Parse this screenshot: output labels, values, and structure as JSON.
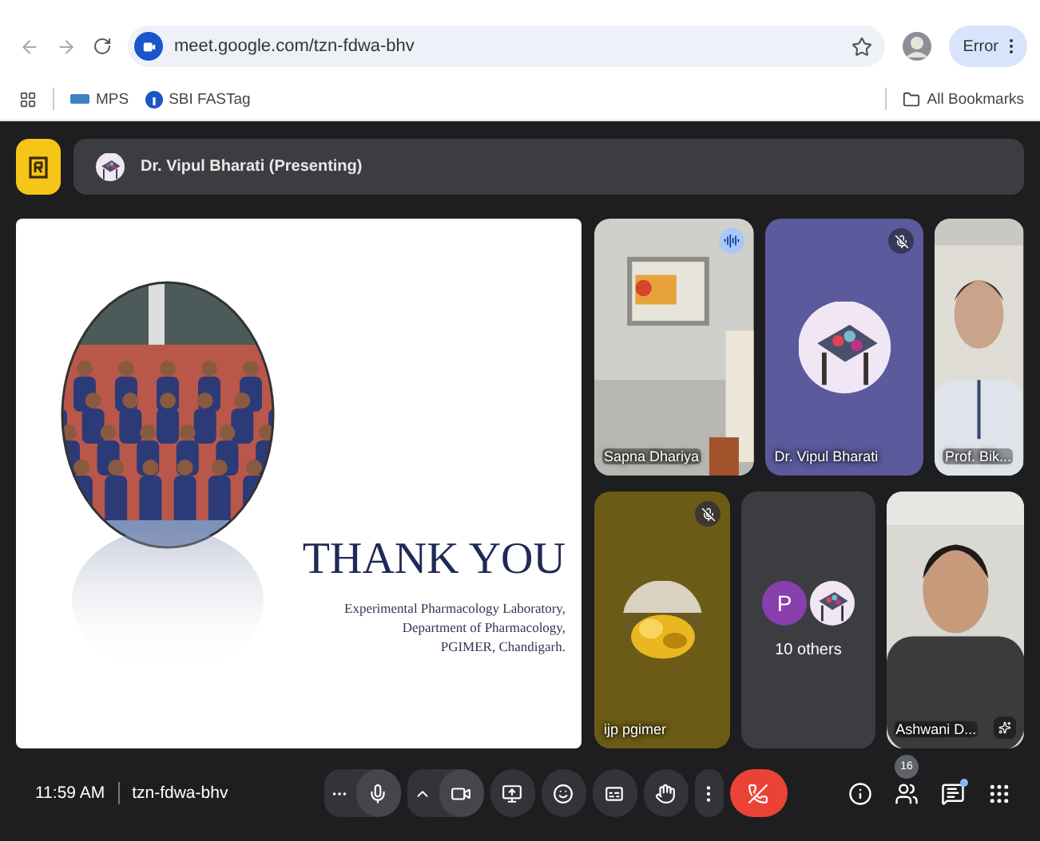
{
  "browser": {
    "url": "meet.google.com/tzn-fdwa-bhv",
    "profile_label": "Error",
    "bookmarks": [
      {
        "label": "MPS"
      },
      {
        "label": "SBI FASTag"
      }
    ],
    "all_bookmarks": "All Bookmarks"
  },
  "presenting_bar": {
    "label": "Dr. Vipul Bharati (Presenting)"
  },
  "slide": {
    "title": "THANK YOU",
    "lines": [
      "Experimental Pharmacology Laboratory,",
      "Department of Pharmacology,",
      "PGIMER, Chandigarh."
    ]
  },
  "tiles": [
    {
      "kind": "video",
      "name": "Sapna Dhariya",
      "speaking": true,
      "muted": false,
      "effects": false
    },
    {
      "kind": "avatar",
      "name": "Dr. Vipul Bharati",
      "speaking": false,
      "muted": true,
      "effects": false,
      "color": "#5a5a9c"
    },
    {
      "kind": "video",
      "name": "Prof. Bik...",
      "speaking": false,
      "muted": false,
      "effects": false
    },
    {
      "kind": "avatar",
      "name": "ijp pgimer",
      "speaking": false,
      "muted": true,
      "effects": false,
      "color": "#6b5b16"
    },
    {
      "kind": "group",
      "label": "10 others",
      "avatars": [
        {
          "kind": "letter",
          "letter": "P",
          "color": "#8a3fae"
        },
        {
          "kind": "picture"
        }
      ]
    },
    {
      "kind": "video",
      "name": "Ashwani D...",
      "speaking": false,
      "muted": false,
      "effects": true
    }
  ],
  "bottom_bar": {
    "time": "11:59 AM",
    "meeting_code": "tzn-fdwa-bhv",
    "participant_count": "16",
    "chat_unread": true
  }
}
